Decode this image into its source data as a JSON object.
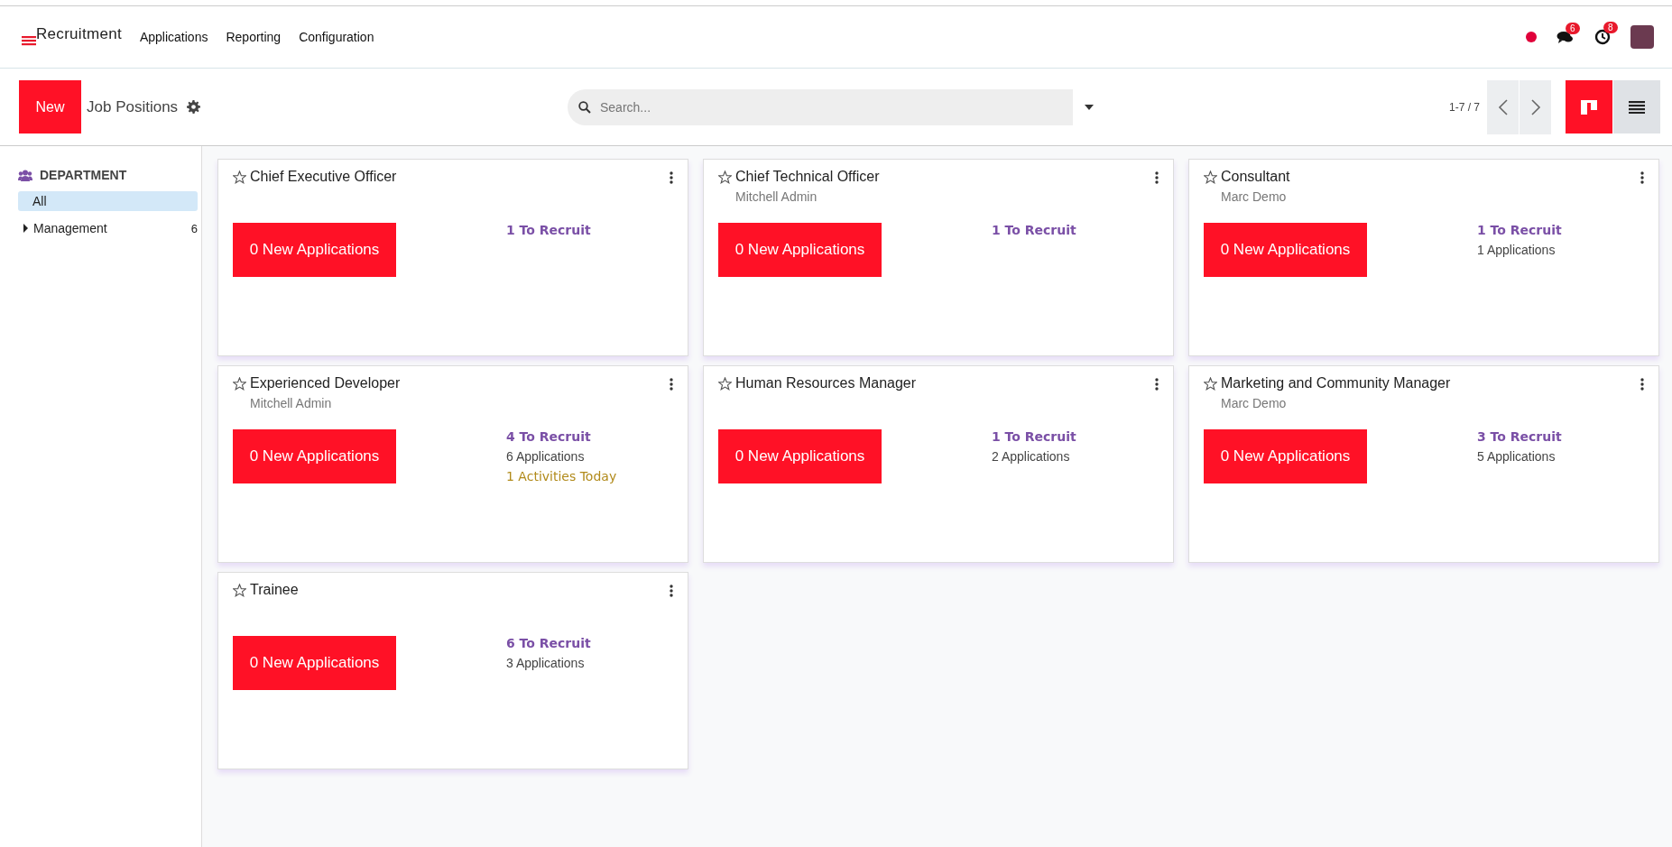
{
  "navbar": {
    "app_name": "Recruitment",
    "menu": [
      "Applications",
      "Reporting",
      "Configuration"
    ],
    "messages_count": "6",
    "activities_count": "8"
  },
  "control_panel": {
    "new_button": "New",
    "title": "Job Positions",
    "search": {
      "placeholder": "Search..."
    },
    "pager": "1-7 / 7",
    "views": [
      {
        "kind": "kanban",
        "selected": true
      },
      {
        "kind": "list",
        "selected": false
      }
    ]
  },
  "sidebar": {
    "heading": "DEPARTMENT",
    "items": [
      {
        "label": "All",
        "selected": true
      },
      {
        "label": "Management",
        "count": "6",
        "selected": false,
        "expanded": false
      }
    ]
  },
  "cards": [
    {
      "title": "Chief Executive Officer",
      "favorite": false,
      "new_applications": "0 New Applications",
      "to_recruit": "1 To Recruit"
    },
    {
      "title": "Chief Technical Officer",
      "favorite": false,
      "responsible": "Mitchell Admin",
      "new_applications": "0 New Applications",
      "to_recruit": "1 To Recruit"
    },
    {
      "title": "Consultant",
      "favorite": false,
      "responsible": "Marc Demo",
      "new_applications": "0 New Applications",
      "to_recruit": "1 To Recruit",
      "applications": "1 Applications"
    },
    {
      "title": "Experienced Developer",
      "favorite": false,
      "responsible": "Mitchell Admin",
      "new_applications": "0 New Applications",
      "to_recruit": "4 To Recruit",
      "applications": "6 Applications",
      "activities": "1 Activities Today"
    },
    {
      "title": "Human Resources Manager",
      "favorite": false,
      "new_applications": "0 New Applications",
      "to_recruit": "1 To Recruit",
      "applications": "2 Applications"
    },
    {
      "title": "Marketing and Community Manager",
      "favorite": false,
      "responsible": "Marc Demo",
      "new_applications": "0 New Applications",
      "to_recruit": "3 To Recruit",
      "applications": "5 Applications"
    },
    {
      "title": "Trainee",
      "favorite": false,
      "new_applications": "0 New Applications",
      "to_recruit": "6 To Recruit",
      "applications": "3 Applications"
    }
  ]
}
